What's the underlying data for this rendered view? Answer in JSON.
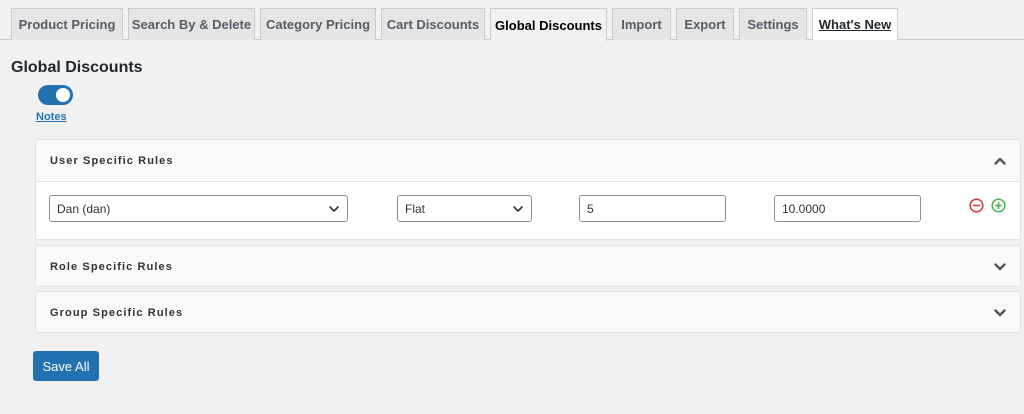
{
  "tabs": [
    {
      "label": "Product Pricing"
    },
    {
      "label": "Search By & Delete"
    },
    {
      "label": "Category Pricing"
    },
    {
      "label": "Cart Discounts"
    },
    {
      "label": "Global Discounts",
      "active": true
    },
    {
      "label": "Import"
    },
    {
      "label": "Export"
    },
    {
      "label": "Settings"
    },
    {
      "label": "What's New"
    }
  ],
  "page": {
    "title": "Global Discounts",
    "toggle_on": true,
    "notes_label": "Notes"
  },
  "panels": {
    "user": {
      "title": "User Specific Rules",
      "expanded": true,
      "rule": {
        "user_value": "Dan (dan)",
        "type_value": "Flat",
        "quantity_value": "5",
        "price_value": "10.0000"
      }
    },
    "role": {
      "title": "Role Specific Rules",
      "expanded": false
    },
    "group": {
      "title": "Group Specific Rules",
      "expanded": false
    }
  },
  "save_label": "Save All",
  "colors": {
    "accent": "#2271b1",
    "remove": "#d63638",
    "add": "#46b450"
  },
  "icons": {
    "collapse": "chevron-up-icon",
    "expand": "chevron-down-icon",
    "remove": "minus-circle-icon",
    "add": "plus-circle-icon"
  }
}
